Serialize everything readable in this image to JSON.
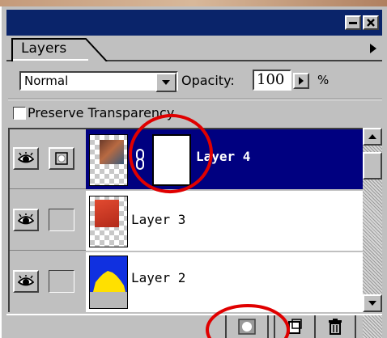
{
  "colors": {
    "titlebar": "#0a246a",
    "selected_row": "#000080",
    "annotation": "#e00000"
  },
  "panel": {
    "tab_label": "Layers",
    "blend_mode": "Normal",
    "opacity_label": "Opacity:",
    "opacity_value": "100",
    "opacity_unit": "%",
    "preserve_transparency_label": "Preserve Transparency",
    "preserve_transparency_checked": false
  },
  "layers": [
    {
      "name": "Layer 4",
      "selected": true,
      "has_mask": true,
      "linked": true
    },
    {
      "name": "Layer 3",
      "selected": false,
      "has_mask": false
    },
    {
      "name": "Layer 2",
      "selected": false,
      "has_mask": false
    }
  ],
  "icons": {
    "minimize": "minimize-icon",
    "close": "close-icon",
    "menu": "panel-menu-arrow-icon",
    "eye": "eye-icon",
    "mask": "layer-mask-icon",
    "link": "link-chain-icon",
    "add_mask": "add-layer-mask-icon",
    "new_layer": "new-layer-icon",
    "delete": "trash-icon"
  }
}
